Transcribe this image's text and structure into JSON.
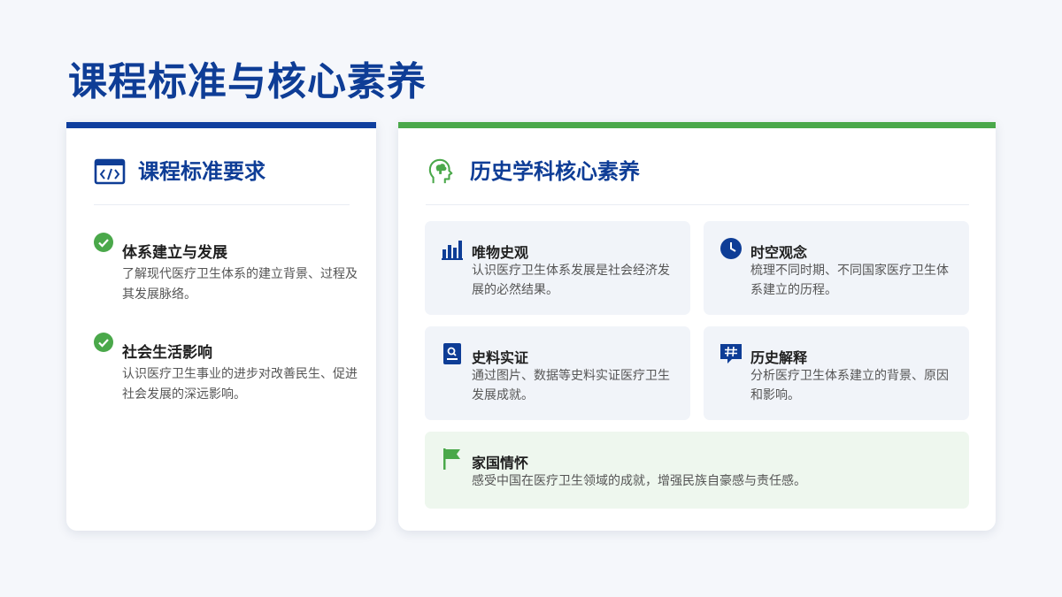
{
  "page": {
    "title": "课程标准与核心素养"
  },
  "colors": {
    "primary_blue": "#0e3d96",
    "accent_green": "#4aa84a"
  },
  "left_card": {
    "title": "课程标准要求",
    "icon": "code-window-icon",
    "items": [
      {
        "title": "体系建立与发展",
        "desc": "了解现代医疗卫生体系的建立背景、过程及其发展脉络。",
        "icon": "check-circle-icon"
      },
      {
        "title": "社会生活影响",
        "desc": "认识医疗卫生事业的进步对改善民生、促进社会发展的深远影响。",
        "icon": "check-circle-icon"
      }
    ]
  },
  "right_card": {
    "title": "历史学科核心素养",
    "icon": "head-brain-icon",
    "tiles": [
      {
        "title": "唯物史观",
        "desc": "认识医疗卫生体系发展是社会经济发展的必然结果。",
        "icon": "bar-chart-icon"
      },
      {
        "title": "时空观念",
        "desc": "梳理不同时期、不同国家医疗卫生体系建立的历程。",
        "icon": "clock-icon"
      },
      {
        "title": "史料实证",
        "desc": "通过图片、数据等史料实证医疗卫生发展成就。",
        "icon": "document-search-icon"
      },
      {
        "title": "历史解释",
        "desc": "分析医疗卫生体系建立的背景、原因和影响。",
        "icon": "hashtag-comment-icon"
      },
      {
        "title": "家国情怀",
        "desc": "感受中国在医疗卫生领域的成就，增强民族自豪感与责任感。",
        "icon": "flag-icon"
      }
    ]
  }
}
